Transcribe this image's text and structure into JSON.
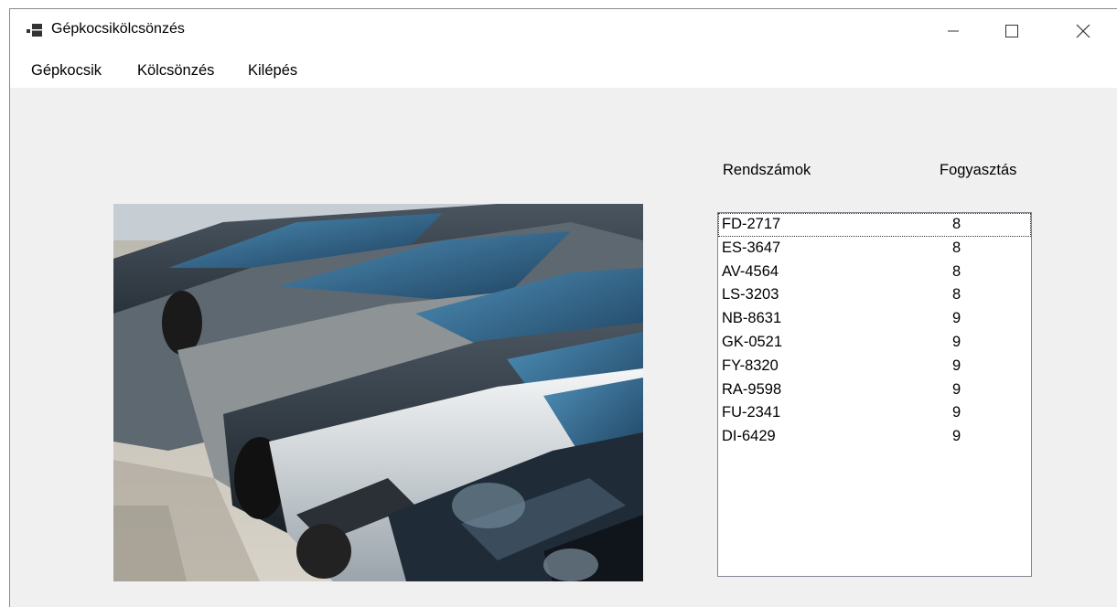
{
  "window": {
    "title": "Gépkocsikölcsönzés",
    "icon": "winforms-app-icon"
  },
  "controls": {
    "minimize": "minimize-icon",
    "maximize": "maximize-icon",
    "close": "close-icon"
  },
  "menu": {
    "items": [
      {
        "label": "Gépkocsik"
      },
      {
        "label": "Kölcsönzés"
      },
      {
        "label": "Kilépés"
      }
    ]
  },
  "headers": {
    "plates": "Rendszámok",
    "consumption": "Fogyasztás"
  },
  "image": {
    "subject": "parked-cars-photo"
  },
  "list": {
    "selected_index": 0,
    "rows": [
      {
        "plate": "FD-2717",
        "consumption": "8"
      },
      {
        "plate": "ES-3647",
        "consumption": "8"
      },
      {
        "plate": "AV-4564",
        "consumption": "8"
      },
      {
        "plate": "LS-3203",
        "consumption": "8"
      },
      {
        "plate": "NB-8631",
        "consumption": "9"
      },
      {
        "plate": "GK-0521",
        "consumption": "9"
      },
      {
        "plate": "FY-8320",
        "consumption": "9"
      },
      {
        "plate": "RA-9598",
        "consumption": "9"
      },
      {
        "plate": "FU-2341",
        "consumption": "9"
      },
      {
        "plate": "DI-6429",
        "consumption": "9"
      }
    ]
  }
}
